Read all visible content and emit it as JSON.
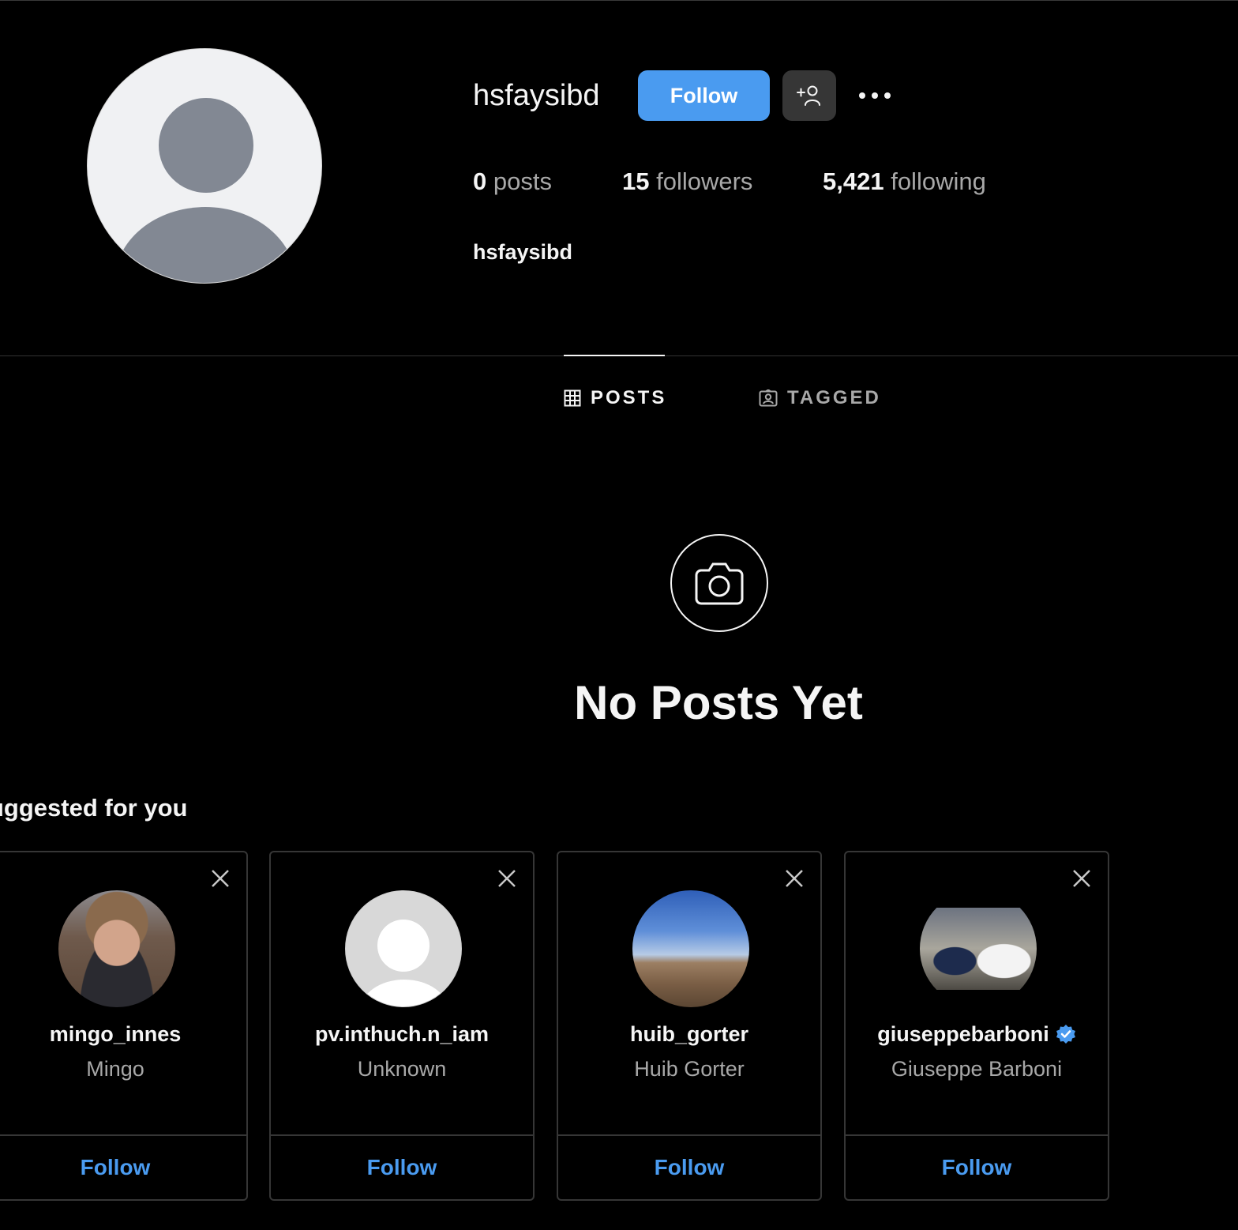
{
  "profile": {
    "username": "hsfaysibd",
    "full_name": "hsfaysibd",
    "follow_label": "Follow",
    "stats": {
      "posts_count": "0",
      "posts_label": "posts",
      "followers_count": "15",
      "followers_label": "followers",
      "following_count": "5,421",
      "following_label": "following"
    }
  },
  "tabs": [
    {
      "label": "POSTS",
      "active": true,
      "icon": "grid-icon"
    },
    {
      "label": "TAGGED",
      "active": false,
      "icon": "tagged-icon"
    }
  ],
  "empty_state": {
    "title": "No Posts Yet",
    "icon": "camera-icon"
  },
  "suggested": {
    "title": "uggested for you",
    "cards": [
      {
        "username": "mingo_innes",
        "display_name": "Mingo",
        "follow_label": "Follow",
        "verified": false
      },
      {
        "username": "pv.inthuch.n_iam",
        "display_name": "Unknown",
        "follow_label": "Follow",
        "verified": false
      },
      {
        "username": "huib_gorter",
        "display_name": "Huib Gorter",
        "follow_label": "Follow",
        "verified": false
      },
      {
        "username": "giuseppebarboni",
        "display_name": "Giuseppe Barboni",
        "follow_label": "Follow",
        "verified": true
      }
    ]
  },
  "colors": {
    "accent": "#4a9bf0",
    "background": "#000000",
    "secondary_text": "#a8a8a8",
    "button_dark": "#363636"
  }
}
